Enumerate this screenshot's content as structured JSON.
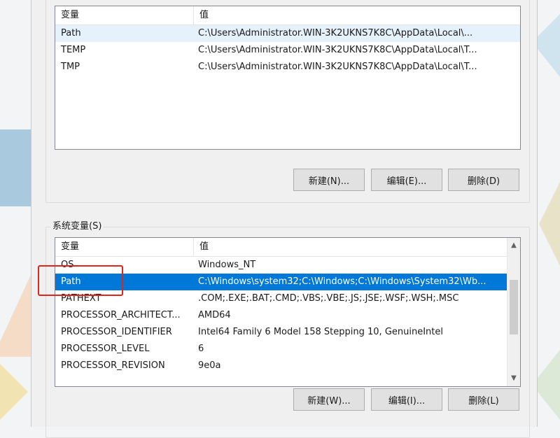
{
  "user_vars": {
    "columns": [
      "变量",
      "值"
    ],
    "rows": [
      {
        "name": "Path",
        "value": "C:\\Users\\Administrator.WIN-3K2UKNS7K8C\\AppData\\Local\\..."
      },
      {
        "name": "TEMP",
        "value": "C:\\Users\\Administrator.WIN-3K2UKNS7K8C\\AppData\\Local\\T..."
      },
      {
        "name": "TMP",
        "value": "C:\\Users\\Administrator.WIN-3K2UKNS7K8C\\AppData\\Local\\T..."
      }
    ],
    "buttons": {
      "new": "新建(N)...",
      "edit": "编辑(E)...",
      "delete": "删除(D)"
    }
  },
  "system_vars": {
    "legend": "系统变量(S)",
    "columns": [
      "变量",
      "值"
    ],
    "rows": [
      {
        "name": "OS",
        "value": "Windows_NT"
      },
      {
        "name": "Path",
        "value": "C:\\Windows\\system32;C:\\Windows;C:\\Windows\\System32\\Wb..."
      },
      {
        "name": "PATHEXT",
        "value": ".COM;.EXE;.BAT;.CMD;.VBS;.VBE;.JS;.JSE;.WSF;.WSH;.MSC"
      },
      {
        "name": "PROCESSOR_ARCHITECT...",
        "value": "AMD64"
      },
      {
        "name": "PROCESSOR_IDENTIFIER",
        "value": "Intel64 Family 6 Model 158 Stepping 10, GenuineIntel"
      },
      {
        "name": "PROCESSOR_LEVEL",
        "value": "6"
      },
      {
        "name": "PROCESSOR_REVISION",
        "value": "9e0a"
      }
    ],
    "selected_row": "Path",
    "buttons": {
      "new": "新建(W)...",
      "edit": "编辑(I)...",
      "delete": "删除(L)"
    }
  },
  "colors": {
    "selection": "#0078d7",
    "annotation": "#e0261c"
  }
}
